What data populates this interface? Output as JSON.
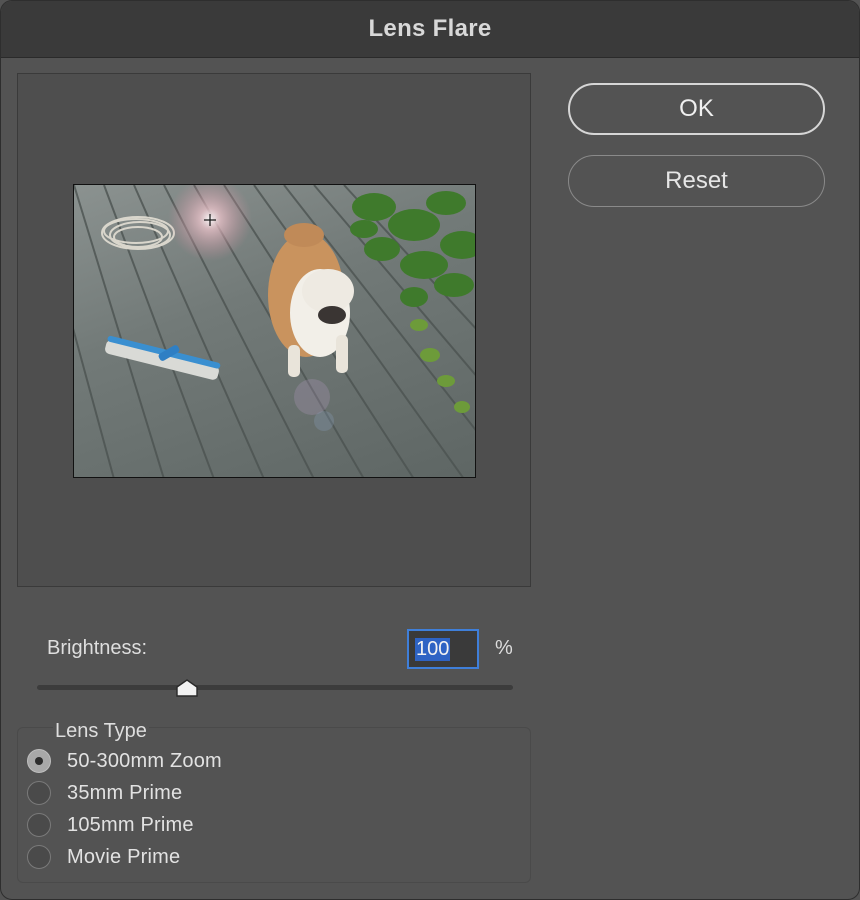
{
  "dialog": {
    "title": "Lens Flare"
  },
  "buttons": {
    "ok_label": "OK",
    "reset_label": "Reset"
  },
  "brightness": {
    "label": "Brightness:",
    "value": "100",
    "unit": "%",
    "slider_fraction": 0.32
  },
  "lens_type": {
    "label": "Lens Type",
    "options": [
      {
        "label": "50-300mm Zoom",
        "selected": true
      },
      {
        "label": "35mm Prime",
        "selected": false
      },
      {
        "label": "105mm Prime",
        "selected": false
      },
      {
        "label": "Movie Prime",
        "selected": false
      }
    ]
  },
  "colors": {
    "accent": "#3f7fd9",
    "selection": "#2e63c4",
    "background": "#535353"
  },
  "icons": {
    "flare_center": "crosshair-icon",
    "slider": "slider-thumb-icon"
  }
}
